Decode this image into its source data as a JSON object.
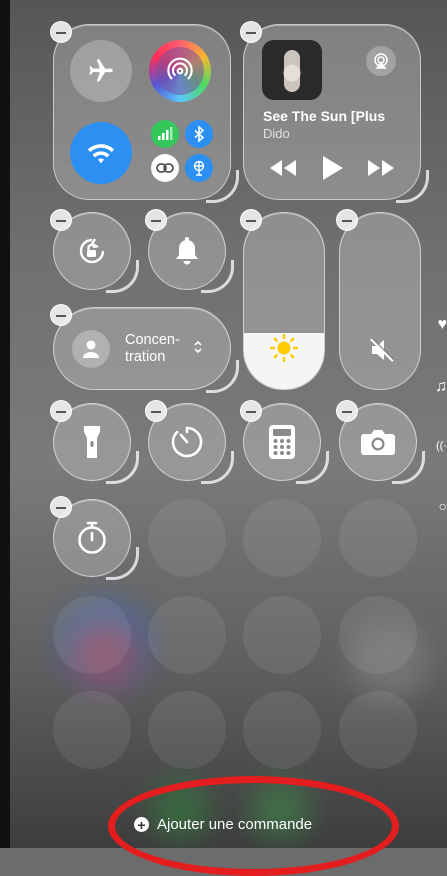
{
  "now_playing": {
    "title": "See The Sun [Plus",
    "artist": "Dido"
  },
  "focus": {
    "label": "Concen-\ntration"
  },
  "add_control": {
    "label": "Ajouter une commande"
  },
  "brightness": {
    "level": 0.32
  },
  "colors": {
    "wifi_blue": "#2c8ff2",
    "bluetooth_blue": "#2c8ff2",
    "cellular_green": "#34c759",
    "annotation_red": "#e41e1e",
    "slider_fill": "#f5f5f5"
  }
}
